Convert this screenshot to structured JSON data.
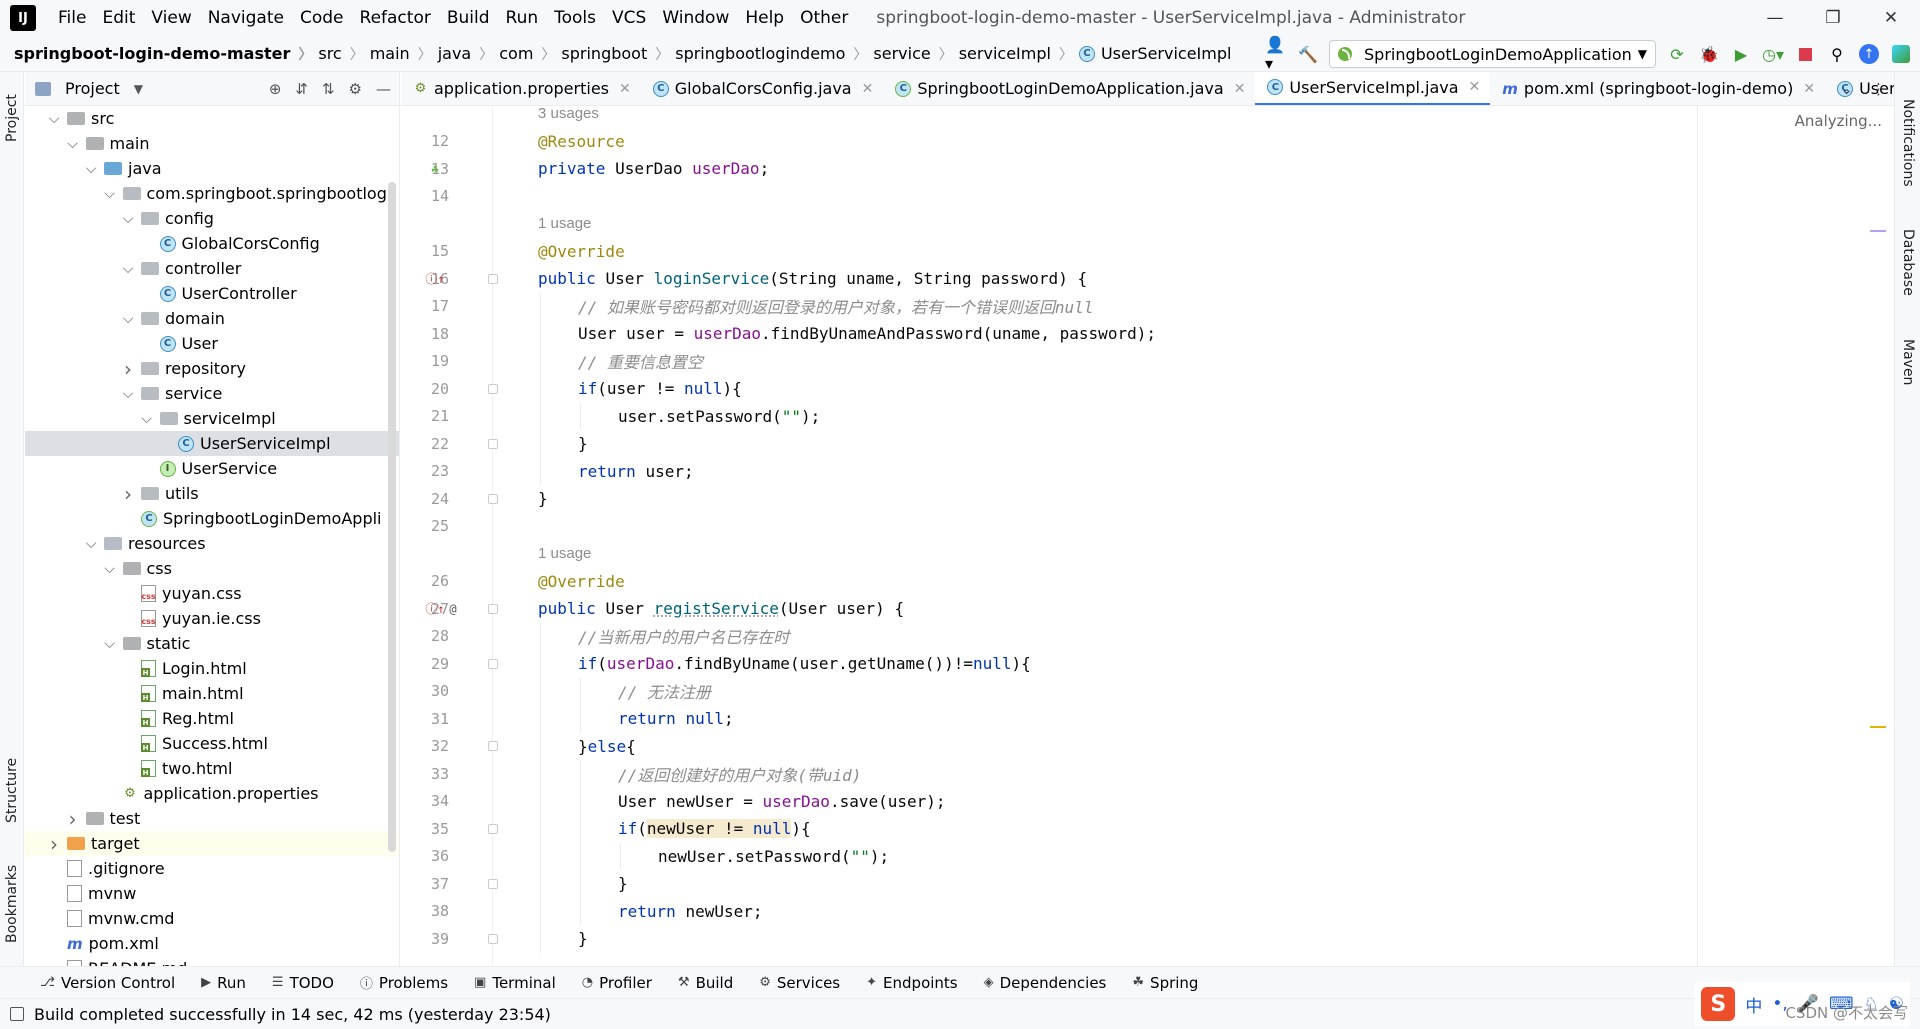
{
  "window": {
    "title": "springboot-login-demo-master - UserServiceImpl.java - Administrator"
  },
  "menu": [
    "File",
    "Edit",
    "View",
    "Navigate",
    "Code",
    "Refactor",
    "Build",
    "Run",
    "Tools",
    "VCS",
    "Window",
    "Help",
    "Other"
  ],
  "breadcrumb": [
    "springboot-login-demo-master",
    "src",
    "main",
    "java",
    "com",
    "springboot",
    "springbootlogindemo",
    "service",
    "serviceImpl",
    "UserServiceImpl"
  ],
  "run_config": "SpringbootLoginDemoApplication",
  "project_panel": {
    "title": "Project",
    "tree": [
      {
        "label": "src",
        "depth": 0,
        "kind": "folder",
        "expanded": true
      },
      {
        "label": "main",
        "depth": 1,
        "kind": "folder",
        "expanded": true
      },
      {
        "label": "java",
        "depth": 2,
        "kind": "folder-blue",
        "expanded": true
      },
      {
        "label": "com.springboot.springbootlogi",
        "depth": 3,
        "kind": "package",
        "expanded": true
      },
      {
        "label": "config",
        "depth": 4,
        "kind": "package",
        "expanded": true
      },
      {
        "label": "GlobalCorsConfig",
        "depth": 5,
        "kind": "class"
      },
      {
        "label": "controller",
        "depth": 4,
        "kind": "package",
        "expanded": true
      },
      {
        "label": "UserController",
        "depth": 5,
        "kind": "class"
      },
      {
        "label": "domain",
        "depth": 4,
        "kind": "package",
        "expanded": true
      },
      {
        "label": "User",
        "depth": 5,
        "kind": "class"
      },
      {
        "label": "repository",
        "depth": 4,
        "kind": "package",
        "expanded": false
      },
      {
        "label": "service",
        "depth": 4,
        "kind": "package",
        "expanded": true
      },
      {
        "label": "serviceImpl",
        "depth": 5,
        "kind": "package",
        "expanded": true
      },
      {
        "label": "UserServiceImpl",
        "depth": 6,
        "kind": "class",
        "selected": true
      },
      {
        "label": "UserService",
        "depth": 5,
        "kind": "interface"
      },
      {
        "label": "utils",
        "depth": 4,
        "kind": "package",
        "expanded": false
      },
      {
        "label": "SpringbootLoginDemoAppli",
        "depth": 4,
        "kind": "spring-class"
      },
      {
        "label": "resources",
        "depth": 2,
        "kind": "folder-res",
        "expanded": true
      },
      {
        "label": "css",
        "depth": 3,
        "kind": "folder",
        "expanded": true
      },
      {
        "label": "yuyan.css",
        "depth": 4,
        "kind": "css"
      },
      {
        "label": "yuyan.ie.css",
        "depth": 4,
        "kind": "css"
      },
      {
        "label": "static",
        "depth": 3,
        "kind": "folder",
        "expanded": true
      },
      {
        "label": "Login.html",
        "depth": 4,
        "kind": "html"
      },
      {
        "label": "main.html",
        "depth": 4,
        "kind": "html"
      },
      {
        "label": "Reg.html",
        "depth": 4,
        "kind": "html"
      },
      {
        "label": "Success.html",
        "depth": 4,
        "kind": "html"
      },
      {
        "label": "two.html",
        "depth": 4,
        "kind": "html"
      },
      {
        "label": "application.properties",
        "depth": 3,
        "kind": "properties"
      },
      {
        "label": "test",
        "depth": 1,
        "kind": "folder",
        "expanded": false
      },
      {
        "label": "target",
        "depth": 0,
        "kind": "folder-orange",
        "expanded": false,
        "highlight": true
      },
      {
        "label": ".gitignore",
        "depth": 0,
        "kind": "file"
      },
      {
        "label": "mvnw",
        "depth": 0,
        "kind": "file"
      },
      {
        "label": "mvnw.cmd",
        "depth": 0,
        "kind": "file"
      },
      {
        "label": "pom.xml",
        "depth": 0,
        "kind": "maven"
      },
      {
        "label": "README.md",
        "depth": 0,
        "kind": "file"
      }
    ]
  },
  "editor_tabs": [
    {
      "label": "application.properties",
      "icon": "properties-icon",
      "active": false
    },
    {
      "label": "GlobalCorsConfig.java",
      "icon": "class-icon",
      "active": false
    },
    {
      "label": "SpringbootLoginDemoApplication.java",
      "icon": "spring-class-icon",
      "active": false
    },
    {
      "label": "UserServiceImpl.java",
      "icon": "class-icon",
      "active": true
    },
    {
      "label": "pom.xml (springboot-login-demo)",
      "icon": "maven-icon",
      "active": false
    },
    {
      "label": "User.java",
      "icon": "class-icon",
      "active": false
    }
  ],
  "editor": {
    "status": "Analyzing...",
    "lines": [
      {
        "type": "hint",
        "text": "3 usages"
      },
      {
        "n": "12",
        "indent": 0,
        "tokens": [
          [
            "an",
            "@Resource"
          ]
        ]
      },
      {
        "n": "13",
        "indent": 0,
        "gutter": "bean-icon",
        "tokens": [
          [
            "k",
            "private "
          ],
          [
            "",
            "UserDao "
          ],
          [
            "fld",
            "userDao"
          ],
          [
            "",
            ";"
          ]
        ]
      },
      {
        "n": "14",
        "indent": 0,
        "tokens": []
      },
      {
        "type": "hint",
        "text": "1 usage"
      },
      {
        "n": "15",
        "indent": 0,
        "tokens": [
          [
            "an",
            "@Override"
          ]
        ]
      },
      {
        "n": "16",
        "indent": 0,
        "gutter": "implements-icon",
        "fold": true,
        "tokens": [
          [
            "k",
            "public "
          ],
          [
            "",
            "User "
          ],
          [
            "mt",
            "loginService"
          ],
          [
            "",
            "(String uname, String password) {"
          ]
        ]
      },
      {
        "n": "17",
        "indent": 1,
        "tokens": [
          [
            "cm",
            "// 如果账号密码都对则返回登录的用户对象，若有一个错误则返回null"
          ]
        ]
      },
      {
        "n": "18",
        "indent": 1,
        "tokens": [
          [
            "",
            "User user = "
          ],
          [
            "fld",
            "userDao"
          ],
          [
            "",
            ".findByUnameAndPassword(uname, password);"
          ]
        ]
      },
      {
        "n": "19",
        "indent": 1,
        "tokens": [
          [
            "cm",
            "// 重要信息置空"
          ]
        ]
      },
      {
        "n": "20",
        "indent": 1,
        "fold": true,
        "tokens": [
          [
            "k",
            "if"
          ],
          [
            "",
            "(user != "
          ],
          [
            "k",
            "null"
          ],
          [
            "",
            "){"
          ]
        ]
      },
      {
        "n": "21",
        "indent": 2,
        "tokens": [
          [
            "",
            "user.setPassword("
          ],
          [
            "st",
            "\"\""
          ],
          [
            "",
            ");"
          ]
        ]
      },
      {
        "n": "22",
        "indent": 1,
        "fold": true,
        "tokens": [
          [
            "",
            "}"
          ]
        ]
      },
      {
        "n": "23",
        "indent": 1,
        "tokens": [
          [
            "k",
            "return "
          ],
          [
            "",
            "user;"
          ]
        ]
      },
      {
        "n": "24",
        "indent": 0,
        "fold": true,
        "tokens": [
          [
            "",
            "}"
          ]
        ]
      },
      {
        "n": "25",
        "indent": 0,
        "tokens": []
      },
      {
        "type": "hint",
        "text": "1 usage"
      },
      {
        "n": "26",
        "indent": 0,
        "tokens": [
          [
            "an",
            "@Override"
          ]
        ]
      },
      {
        "n": "27",
        "indent": 0,
        "gutter": "implements-icon",
        "gutter2": "at-icon",
        "fold": true,
        "tokens": [
          [
            "k",
            "public "
          ],
          [
            "",
            "User "
          ],
          [
            "mt ul",
            "registService"
          ],
          [
            "",
            "(User user) {"
          ]
        ]
      },
      {
        "n": "28",
        "indent": 1,
        "tokens": [
          [
            "cm",
            "//当新用户的用户名已存在时"
          ]
        ]
      },
      {
        "n": "29",
        "indent": 1,
        "fold": true,
        "tokens": [
          [
            "k",
            "if"
          ],
          [
            "",
            "("
          ],
          [
            "fld",
            "userDao"
          ],
          [
            "",
            ".findByUname(user.getUname())!="
          ],
          [
            "k",
            "null"
          ],
          [
            "",
            "){"
          ]
        ]
      },
      {
        "n": "30",
        "indent": 2,
        "tokens": [
          [
            "cm",
            "// 无法注册"
          ]
        ]
      },
      {
        "n": "31",
        "indent": 2,
        "tokens": [
          [
            "k",
            "return "
          ],
          [
            "k",
            "null"
          ],
          [
            "",
            ";"
          ]
        ]
      },
      {
        "n": "32",
        "indent": 1,
        "fold": true,
        "tokens": [
          [
            "",
            "}"
          ],
          [
            "k",
            "else"
          ],
          [
            "",
            "{"
          ]
        ]
      },
      {
        "n": "33",
        "indent": 2,
        "tokens": [
          [
            "cm",
            "//返回创建好的用户对象(带uid)"
          ]
        ]
      },
      {
        "n": "34",
        "indent": 2,
        "tokens": [
          [
            "",
            "User newUser = "
          ],
          [
            "fld",
            "userDao"
          ],
          [
            "",
            ".save(user);"
          ]
        ]
      },
      {
        "n": "35",
        "indent": 2,
        "fold": true,
        "tokens": [
          [
            "k",
            "if"
          ],
          [
            "",
            "("
          ],
          [
            "hl",
            "newUser != "
          ],
          [
            "k hl",
            "null"
          ],
          [
            "",
            "){"
          ]
        ]
      },
      {
        "n": "36",
        "indent": 3,
        "tokens": [
          [
            "",
            "newUser.setPassword("
          ],
          [
            "st",
            "\"\""
          ],
          [
            "",
            ");"
          ]
        ]
      },
      {
        "n": "37",
        "indent": 2,
        "fold": true,
        "tokens": [
          [
            "",
            "}"
          ]
        ]
      },
      {
        "n": "38",
        "indent": 2,
        "tokens": [
          [
            "k",
            "return "
          ],
          [
            "",
            "newUser;"
          ]
        ]
      },
      {
        "n": "39",
        "indent": 1,
        "fold": true,
        "tokens": [
          [
            "",
            "}"
          ]
        ]
      }
    ]
  },
  "left_strip": [
    "Project",
    "Structure",
    "Bookmarks"
  ],
  "right_strip": [
    "Notifications",
    "Database",
    "Maven"
  ],
  "tool_windows": [
    {
      "label": "Version Control",
      "icon": "branch-icon"
    },
    {
      "label": "Run",
      "icon": "run-icon"
    },
    {
      "label": "TODO",
      "icon": "list-icon"
    },
    {
      "label": "Problems",
      "icon": "problems-icon"
    },
    {
      "label": "Terminal",
      "icon": "terminal-icon"
    },
    {
      "label": "Profiler",
      "icon": "profiler-icon"
    },
    {
      "label": "Build",
      "icon": "hammer-icon"
    },
    {
      "label": "Services",
      "icon": "services-icon"
    },
    {
      "label": "Endpoints",
      "icon": "endpoints-icon"
    },
    {
      "label": "Dependencies",
      "icon": "dependencies-icon"
    },
    {
      "label": "Spring",
      "icon": "spring-icon"
    }
  ],
  "status_bar": {
    "text": "Build completed successfully in 14 sec, 42 ms (yesterday 23:54)"
  },
  "ime": {
    "lang": "中",
    "punct": "•,"
  },
  "watermark": "CSDN @不太会写"
}
